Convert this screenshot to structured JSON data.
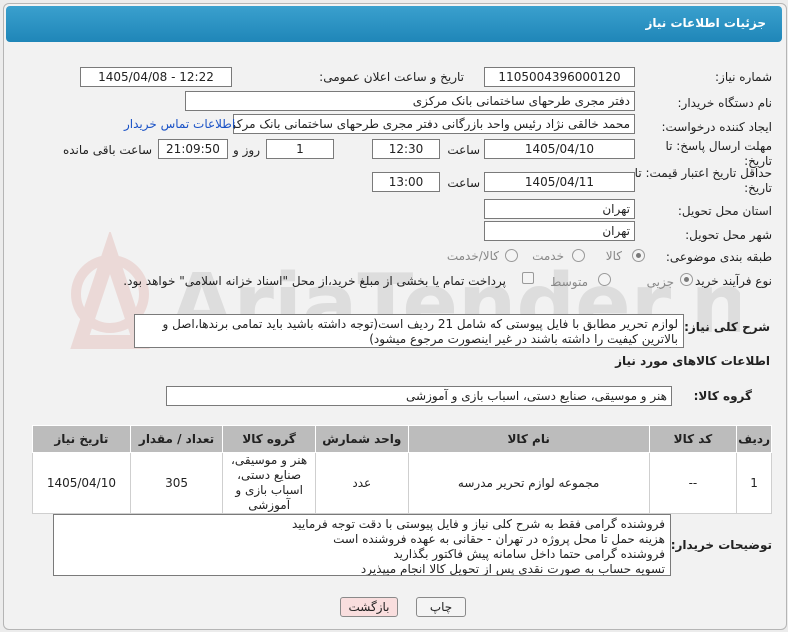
{
  "header": {
    "title": "جزئیات اطلاعات نیاز"
  },
  "need_number": {
    "label": "شماره نیاز:",
    "value": "1105004396000120"
  },
  "announce": {
    "label": "تاریخ و ساعت اعلان عمومی:",
    "value": "1405/04/08 - 12:22"
  },
  "buyer": {
    "label": "نام دستگاه خریدار:",
    "value": "دفتر مجری طرحهای ساختمانی بانک مرکزی"
  },
  "creator": {
    "label": "ایجاد کننده درخواست:",
    "value": "محمد خالقی نژاد رئیس واحد بازرگانی دفتر مجری طرحهای ساختمانی بانک مرکزی",
    "contact_link": "اطلاعات تماس خریدار"
  },
  "deadline": {
    "label": "مهلت ارسال پاسخ: تا تاریخ:",
    "date": "1405/04/10",
    "time_label": "ساعت",
    "time": "12:30",
    "days": "1",
    "days_label": "روز و",
    "remaining": "21:09:50",
    "remaining_label": "ساعت باقی مانده"
  },
  "price_validity": {
    "label": "حداقل تاریخ اعتبار قیمت: تا تاریخ:",
    "date": "1405/04/11",
    "time_label": "ساعت",
    "time": "13:00"
  },
  "province": {
    "label": "استان محل تحویل:",
    "value": "تهران"
  },
  "city": {
    "label": "شهر محل تحویل:",
    "value": "تهران"
  },
  "category": {
    "label": "طبقه بندی موضوعی:",
    "options": [
      "کالا",
      "خدمت",
      "کالا/خدمت"
    ],
    "selected": 0
  },
  "process": {
    "label": "نوع فرآیند خرید :",
    "options": [
      "جزیی",
      "متوسط"
    ],
    "selected": 0,
    "payment_note": "پرداخت تمام یا بخشی از مبلغ خرید،از محل \"اسناد خزانه اسلامی\" خواهد بود."
  },
  "description": {
    "label": "شرح کلی نیاز:",
    "text": "لوازم تحریر مطابق با فایل پیوستی که شامل 21 ردیف است(توجه داشته باشید باید تمامی برندها،اصل و بالاترین کیفیت را داشته باشند در غیر اینصورت مرجوع میشود)"
  },
  "goods_section": {
    "title": "اطلاعات کالاهای مورد نیاز"
  },
  "goods_group": {
    "label": "گروه کالا:",
    "value": "هنر و موسیقی، صنایع دستی، اسباب بازی و آموزشی"
  },
  "table": {
    "headers": [
      "ردیف",
      "کد کالا",
      "نام کالا",
      "واحد شمارش",
      "گروه کالا",
      "تعداد / مقدار",
      "تاریخ نیاز"
    ],
    "rows": [
      {
        "row": "1",
        "code": "--",
        "name": "مجموعه لوازم تحریر مدرسه",
        "unit": "عدد",
        "group": "هنر و موسیقی، صنایع دستی، اسباب بازی و آموزشی",
        "qty": "305",
        "date": "1405/04/10"
      }
    ]
  },
  "buyer_notes": {
    "label": "توضیحات خریدار:",
    "lines": [
      "فروشنده گرامی فقط به شرح کلی نیاز و فایل پیوستی با دقت توجه فرمایید",
      "هزینه حمل تا محل پروژه در تهران - حقانی به عهده فروشنده است",
      "فروشنده گرامی حتما داخل سامانه پیش فاکتور بگذارید",
      "تسویه حساب به صورت نقدی پس از تحویل کالا  انجام میپذیرد"
    ]
  },
  "buttons": {
    "print": "چاپ",
    "back": "بازگشت"
  },
  "watermark": {
    "text": "AriaTender.net"
  },
  "colors": {
    "header": "#2b93c4",
    "link": "#1a52c6",
    "back_button": "#f9dede"
  }
}
